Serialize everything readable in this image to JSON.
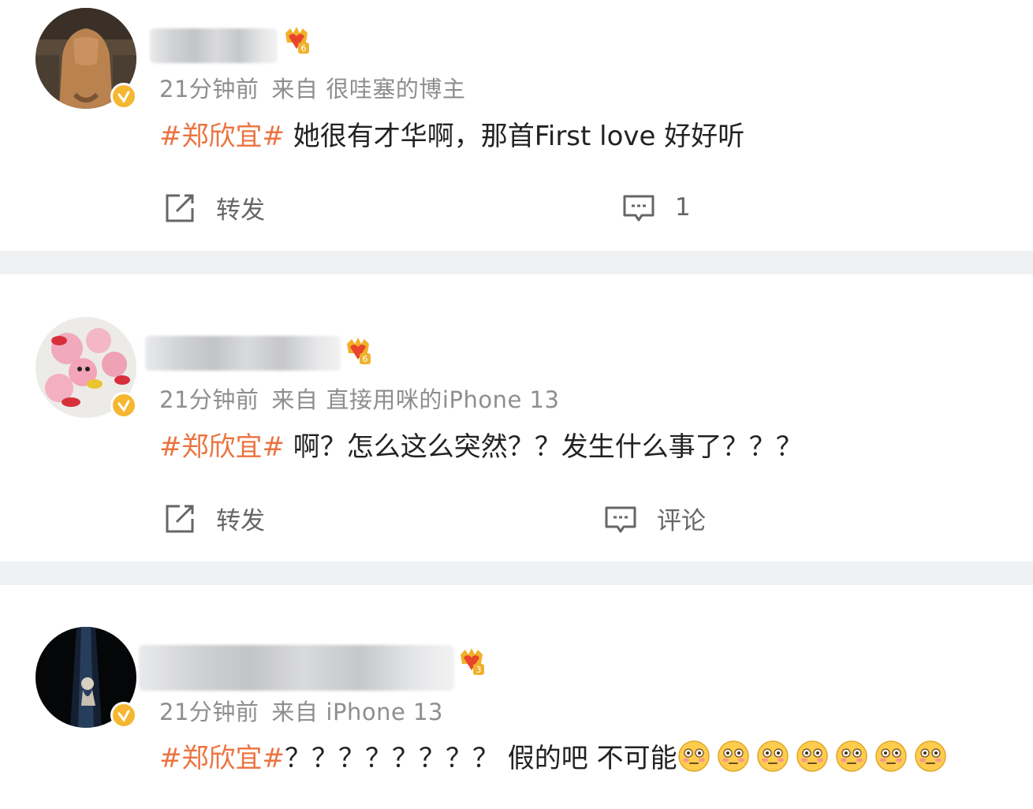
{
  "posts": [
    {
      "time": "21分钟前",
      "from": "来自",
      "source": "很哇塞的博主",
      "hashtag": "#郑欣宜#",
      "text": " 她很有才华啊，那首First love 好好听",
      "emoji_count": 0,
      "repost_label": "转发",
      "comment_label": "1",
      "fan_level": "6"
    },
    {
      "time": "21分钟前",
      "from": "来自",
      "source": "直接用咪的iPhone 13",
      "hashtag": "#郑欣宜#",
      "text": " 啊？怎么这么突然？？发生什么事了？？？",
      "emoji_count": 0,
      "repost_label": "转发",
      "comment_label": "评论",
      "fan_level": "6"
    },
    {
      "time": "21分钟前",
      "from": "来自",
      "source": "iPhone 13",
      "hashtag": "#郑欣宜#",
      "text": "？？？？？？？？ 假的吧 不可能",
      "emoji_count": 7,
      "fan_level": "3"
    }
  ],
  "icons": {
    "repost": "share-icon",
    "comment": "comment-icon",
    "verified": "verified-badge-icon",
    "fan_badge": "fan-badge-icon",
    "emoji": "flushed-face-emoji-icon"
  },
  "colors": {
    "hashtag": "#eb7340",
    "meta": "#8e8e8e",
    "text": "#222222",
    "verified": "#f5b731",
    "separator": "#f0f1f3"
  }
}
